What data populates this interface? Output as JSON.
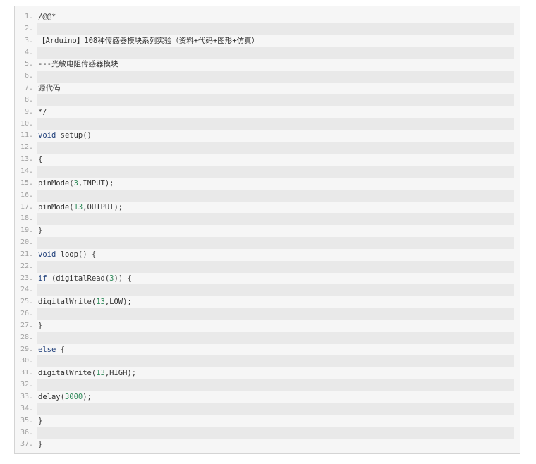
{
  "code_block": {
    "lines": [
      {
        "n": "1.",
        "text": "/@@*"
      },
      {
        "n": "2.",
        "text": ""
      },
      {
        "n": "3.",
        "text": "【Arduino】108种传感器模块系列实验（资料+代码+图形+仿真）"
      },
      {
        "n": "4.",
        "text": ""
      },
      {
        "n": "5.",
        "text": "---光敏电阻传感器模块"
      },
      {
        "n": "6.",
        "text": ""
      },
      {
        "n": "7.",
        "text": "源代码"
      },
      {
        "n": "8.",
        "text": ""
      },
      {
        "n": "9.",
        "text": "*/"
      },
      {
        "n": "10.",
        "text": ""
      },
      {
        "n": "11.",
        "text": "void setup()"
      },
      {
        "n": "12.",
        "text": ""
      },
      {
        "n": "13.",
        "text": "{"
      },
      {
        "n": "14.",
        "text": ""
      },
      {
        "n": "15.",
        "text": "pinMode(3,INPUT);"
      },
      {
        "n": "16.",
        "text": ""
      },
      {
        "n": "17.",
        "text": "pinMode(13,OUTPUT);"
      },
      {
        "n": "18.",
        "text": ""
      },
      {
        "n": "19.",
        "text": "}"
      },
      {
        "n": "20.",
        "text": ""
      },
      {
        "n": "21.",
        "text": "void loop() {"
      },
      {
        "n": "22.",
        "text": ""
      },
      {
        "n": "23.",
        "text": "if (digitalRead(3)) {"
      },
      {
        "n": "24.",
        "text": ""
      },
      {
        "n": "25.",
        "text": "digitalWrite(13,LOW);"
      },
      {
        "n": "26.",
        "text": ""
      },
      {
        "n": "27.",
        "text": "}"
      },
      {
        "n": "28.",
        "text": ""
      },
      {
        "n": "29.",
        "text": "else {"
      },
      {
        "n": "30.",
        "text": ""
      },
      {
        "n": "31.",
        "text": "digitalWrite(13,HIGH);"
      },
      {
        "n": "32.",
        "text": ""
      },
      {
        "n": "33.",
        "text": "delay(3000);"
      },
      {
        "n": "34.",
        "text": ""
      },
      {
        "n": "35.",
        "text": "}"
      },
      {
        "n": "36.",
        "text": ""
      },
      {
        "n": "37.",
        "text": "}"
      }
    ]
  },
  "colors": {
    "background": "#f6f6f6",
    "alt_row": "#e9e9e9",
    "line_number": "#a0a0a0",
    "keyword": "#1f3f7a",
    "number": "#2f8a5a"
  }
}
